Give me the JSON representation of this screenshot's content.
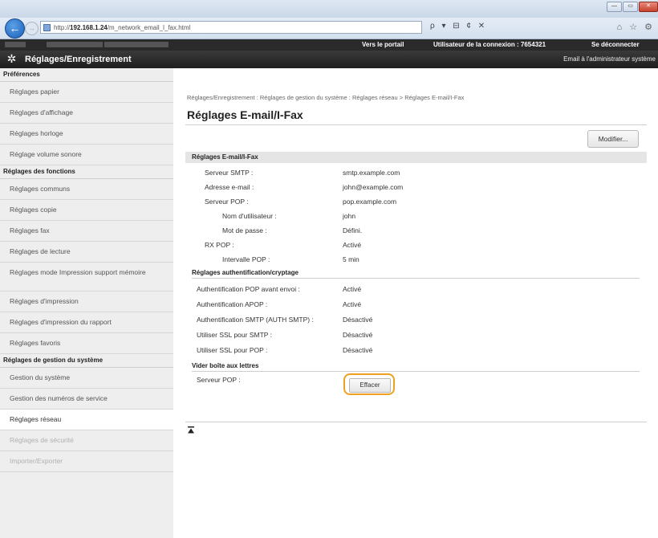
{
  "browser": {
    "url_prefix": "http://",
    "url_host": "192.168.1.24",
    "url_path": "/m_network_email_l_fax.html",
    "controls": "ρ ▾ ⊟ ¢ ✕",
    "window_buttons": [
      "—",
      "▭",
      "✕"
    ]
  },
  "header": {
    "portal_link": "Vers le portail",
    "user_label": "Utilisateur de la connexion : 7654321",
    "logout": "Se déconnecter",
    "app_title": "Réglages/Enregistrement",
    "admin_mail": "Email à l'administrateur système"
  },
  "sidebar": {
    "sections": [
      {
        "title": "Préférences",
        "items": [
          {
            "label": "Réglages papier"
          },
          {
            "label": "Réglages d'affichage"
          },
          {
            "label": "Réglages horloge"
          },
          {
            "label": "Réglage volume sonore"
          }
        ]
      },
      {
        "title": "Réglages des fonctions",
        "items": [
          {
            "label": "Réglages communs"
          },
          {
            "label": "Réglages copie"
          },
          {
            "label": "Réglages fax"
          },
          {
            "label": "Réglages de lecture"
          },
          {
            "label": "Réglages mode Impression support mémoire"
          },
          {
            "label": "Réglages d'impression"
          },
          {
            "label": "Réglages d'impression du rapport"
          },
          {
            "label": "Réglages favoris"
          }
        ]
      },
      {
        "title": "Réglages de gestion du système",
        "items": [
          {
            "label": "Gestion du système"
          },
          {
            "label": "Gestion des numéros de service"
          },
          {
            "label": "Réglages réseau"
          },
          {
            "label": "Réglages de sécurité"
          },
          {
            "label": "Importer/Exporter"
          }
        ]
      }
    ]
  },
  "main": {
    "breadcrumb": "Réglages/Enregistrement : Réglages de gestion du système : Réglages réseau > Réglages E-mail/I-Fax",
    "title": "Réglages E-mail/I-Fax",
    "modify_button": "Modifier...",
    "panel_title": "Réglages E-mail/I-Fax",
    "settings": [
      {
        "label": "Serveur SMTP :",
        "value": "smtp.example.com"
      },
      {
        "label": "Adresse e-mail :",
        "value": "john@example.com"
      },
      {
        "label": "Serveur POP :",
        "value": "pop.example.com"
      },
      {
        "label": "Nom d'utilisateur :",
        "value": "john"
      },
      {
        "label": "Mot de passe :",
        "value": "Défini."
      },
      {
        "label": "RX POP :",
        "value": "Activé"
      },
      {
        "label": "Intervalle POP :",
        "value": "5 min"
      }
    ],
    "auth_title": "Réglages authentification/cryptage",
    "auth_settings": [
      {
        "label": "Authentification POP avant envoi :",
        "value": "Activé"
      },
      {
        "label": "Authentification APOP :",
        "value": "Activé"
      },
      {
        "label": "Authentification SMTP (AUTH SMTP) :",
        "value": "Désactivé"
      },
      {
        "label": "Utiliser SSL pour SMTP :",
        "value": "Désactivé"
      },
      {
        "label": "Utiliser SSL pour POP :",
        "value": "Désactivé"
      }
    ],
    "clear_title": "Vider boîte aux lettres",
    "clear_label": "Serveur POP :",
    "clear_button": "Effacer"
  }
}
